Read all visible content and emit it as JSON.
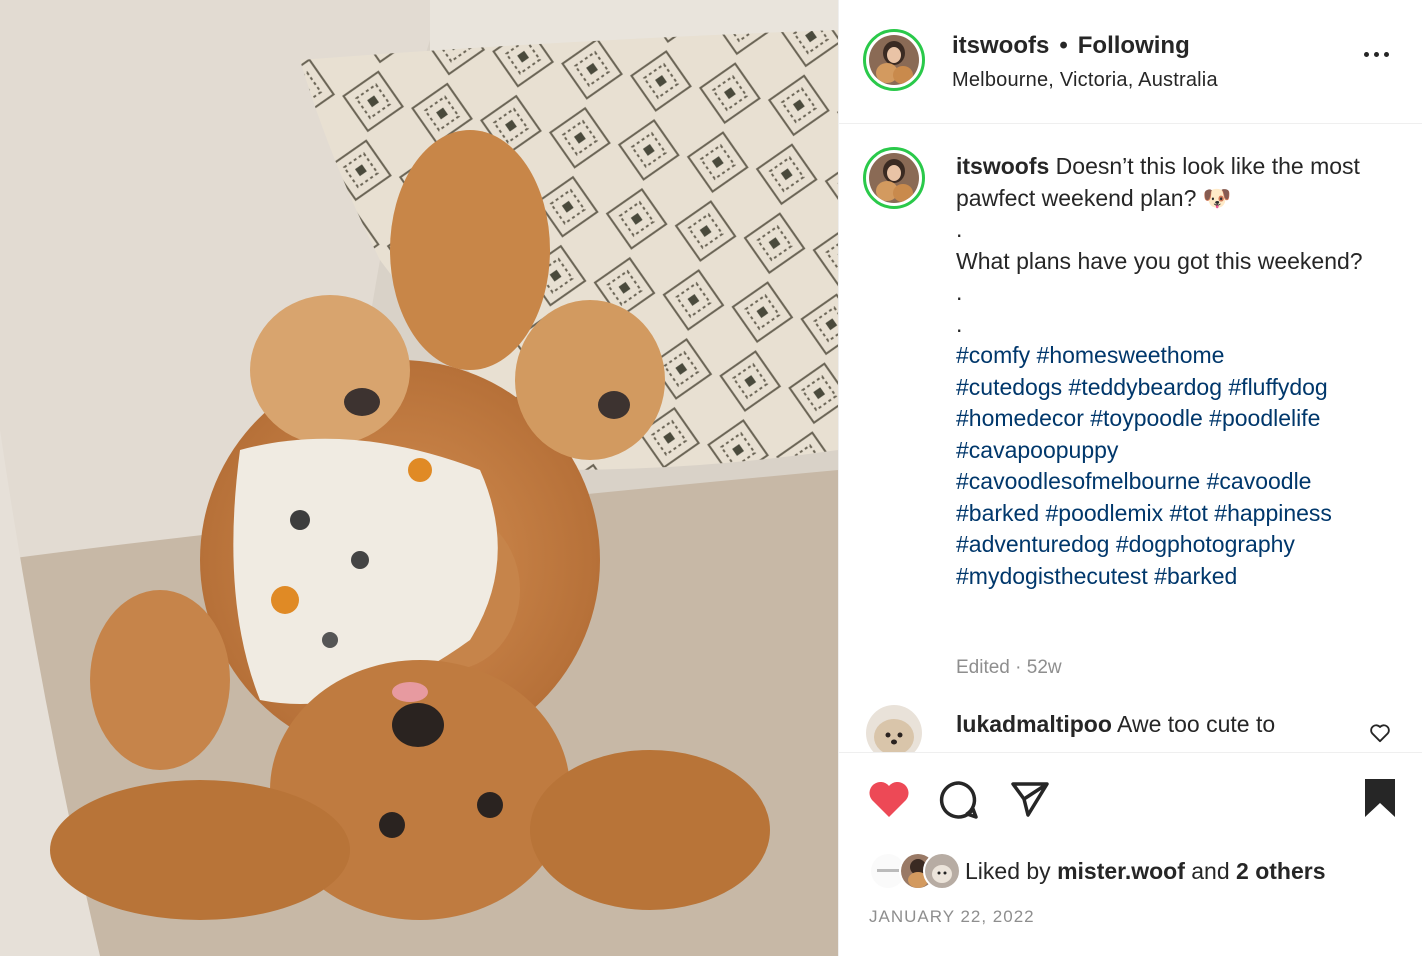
{
  "post": {
    "username": "itswoofs",
    "separator": "•",
    "follow_status": "Following",
    "location": "Melbourne, Victoria, Australia",
    "more_icon": "more-horizontal-icon"
  },
  "caption": {
    "username": "itswoofs",
    "text": "Doesn’t this look like the most pawfect weekend plan? 🐶",
    "dot1": ".",
    "question": "What plans have you got this weekend?",
    "dot2": ".",
    "dot3": ".",
    "hashtags": [
      "#comfy #homesweethome",
      "#cutedogs #teddybeardog #fluffydog",
      "#homedecor #toypoodle #poodlelife",
      "#cavapoopuppy",
      "#cavoodlesofmelbourne #cavoodle",
      "#barked #poodlemix #tot #happiness",
      "#adventuredog #dogphotography",
      "#mydogisthecutest #barked"
    ],
    "meta": "Edited · 52w"
  },
  "comments": [
    {
      "username": "lukadmaltipoo",
      "text": "Awe too cute to"
    }
  ],
  "actions": {
    "like_icon": "heart-filled-icon",
    "comment_icon": "comment-icon",
    "share_icon": "share-icon",
    "save_icon": "bookmark-filled-icon",
    "liked_prefix": "Liked by ",
    "liked_user": "mister.woof",
    "liked_and": " and ",
    "liked_others": "2 others",
    "date": "JANUARY 22, 2022"
  },
  "colors": {
    "like": "#ed4956",
    "story_ring": "#2ac94a",
    "hashtag": "#00376b",
    "muted": "#8e8e8e"
  }
}
